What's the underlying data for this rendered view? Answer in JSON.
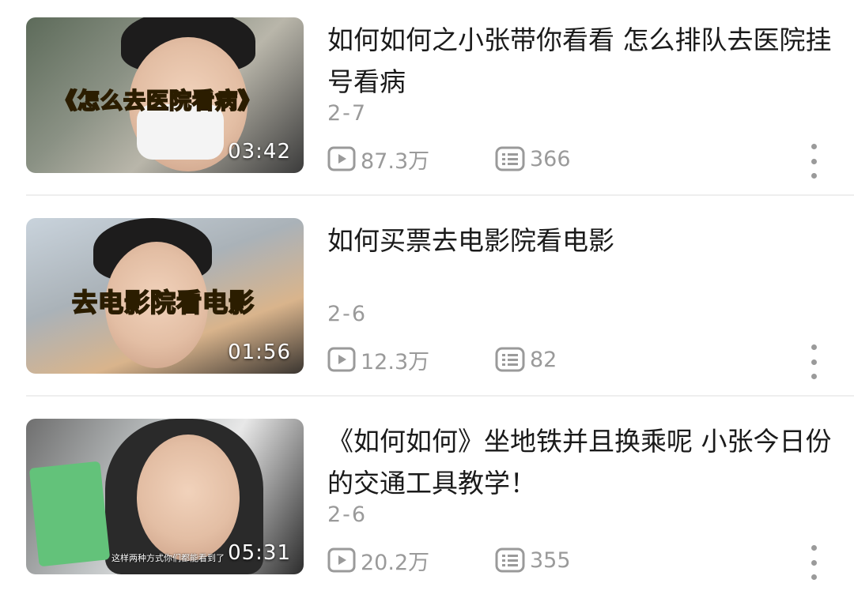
{
  "videos": [
    {
      "title": "如何如何之小张带你看看 怎么排队去医院挂号看病",
      "thumb_caption": "《怎么去医院看病》",
      "duration": "03:42",
      "date": "2-7",
      "views": "87.3万",
      "comments": "366"
    },
    {
      "title": "如何买票去电影院看电影",
      "thumb_caption": "去电影院看电影",
      "duration": "01:56",
      "date": "2-6",
      "views": "12.3万",
      "comments": "82"
    },
    {
      "title": "《如何如何》坐地铁并且换乘呢 小张今日份的交通工具教学！",
      "thumb_subtitle": "这样两种方式你们都能看到了",
      "duration": "05:31",
      "date": "2-6",
      "views": "20.2万",
      "comments": "355"
    }
  ],
  "icons": {
    "views": "play-icon",
    "comments": "danmaku-icon",
    "more": "more-vertical-icon"
  },
  "colors": {
    "muted": "#9a9a9a",
    "caption": "#ffe45a"
  }
}
